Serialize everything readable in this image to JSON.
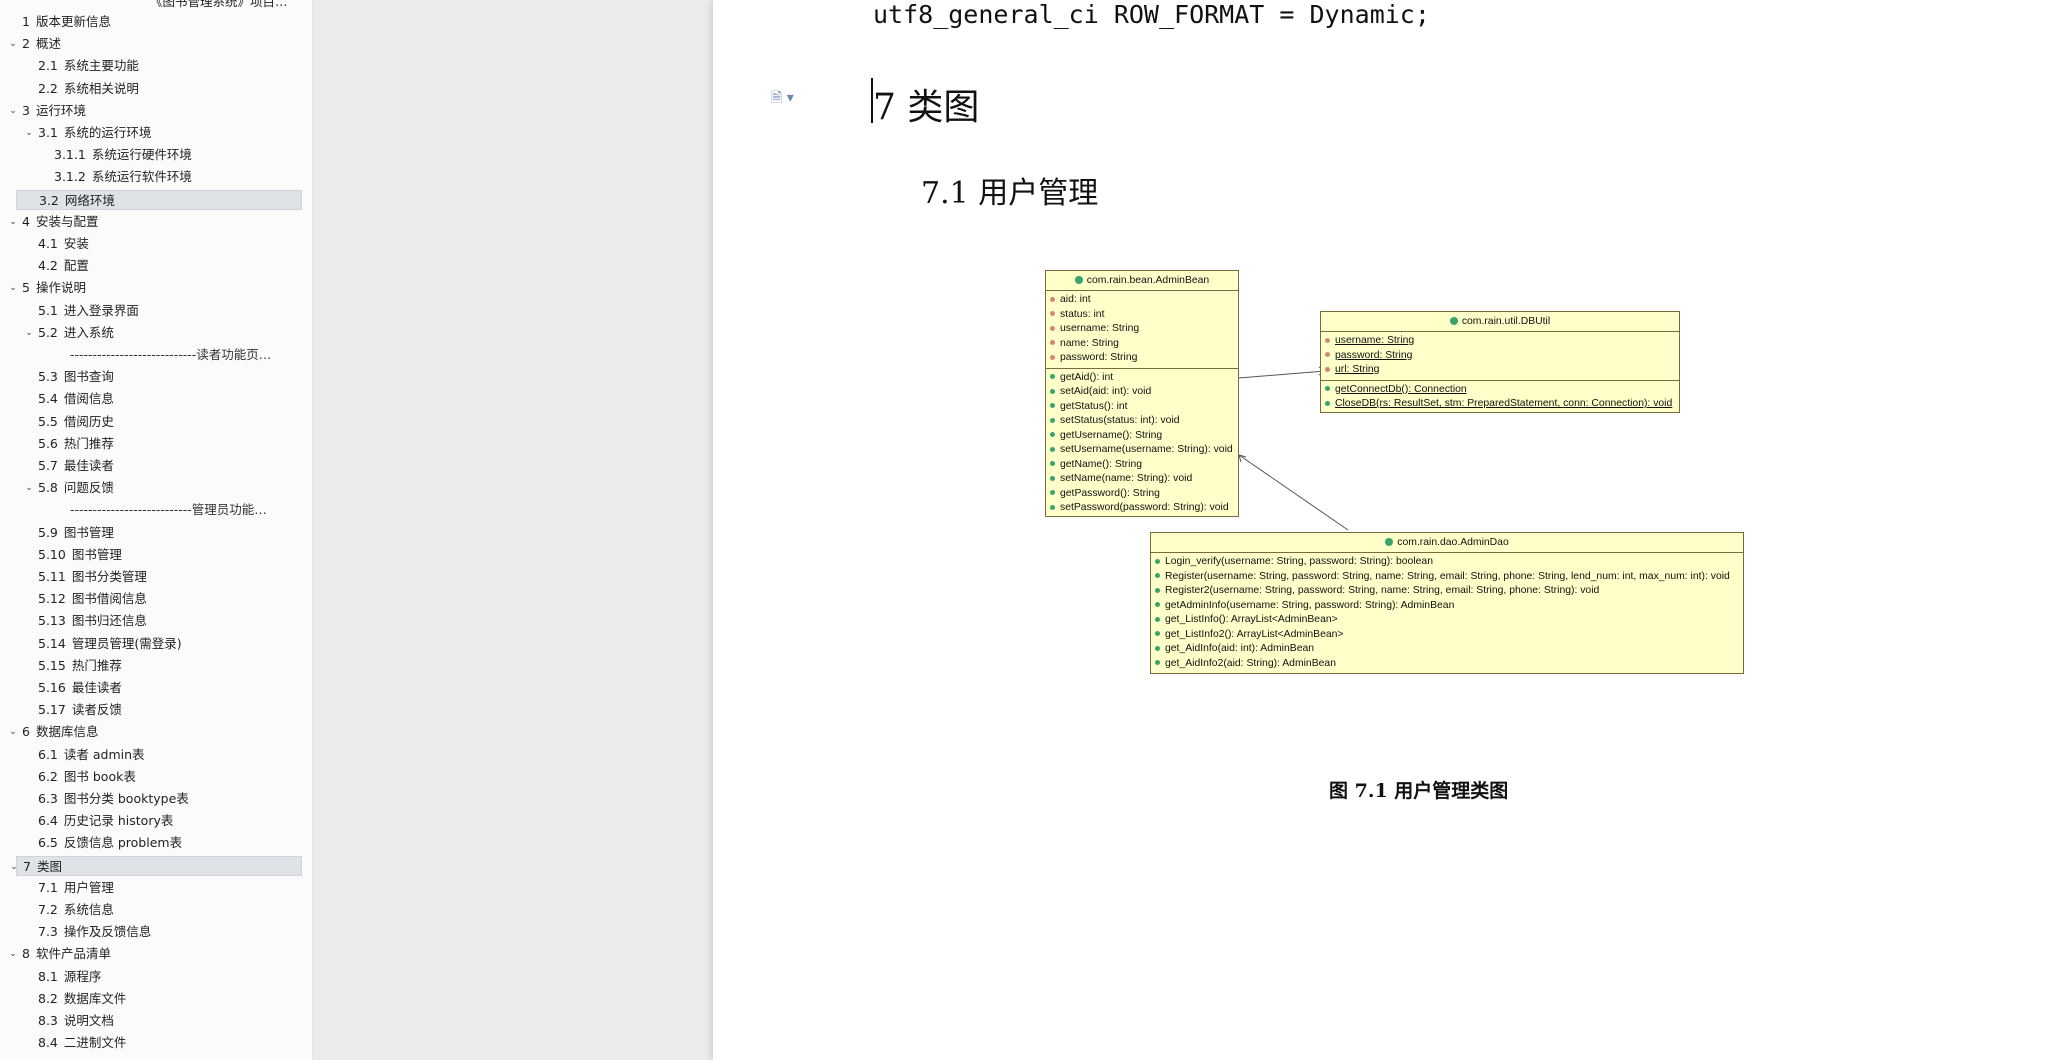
{
  "nav": {
    "top_partial": "《图书管理系统》项目…",
    "items": [
      {
        "num": "1",
        "label": "版本更新信息",
        "level": 1,
        "chev": false
      },
      {
        "num": "2",
        "label": "概述",
        "level": 1,
        "chev": true
      },
      {
        "num": "2.1",
        "label": "系统主要功能",
        "level": 2,
        "chev": false
      },
      {
        "num": "2.2",
        "label": "系统相关说明",
        "level": 2,
        "chev": false
      },
      {
        "num": "3",
        "label": "运行环境",
        "level": 1,
        "chev": true
      },
      {
        "num": "3.1",
        "label": "系统的运行环境",
        "level": 2,
        "chev": true
      },
      {
        "num": "3.1.1",
        "label": "系统运行硬件环境",
        "level": 3,
        "chev": false
      },
      {
        "num": "3.1.2",
        "label": "系统运行软件环境",
        "level": 3,
        "chev": false
      },
      {
        "num": "3.2",
        "label": "网络环境",
        "level": 2,
        "chev": false,
        "selected": true
      },
      {
        "num": "4",
        "label": "安装与配置",
        "level": 1,
        "chev": true
      },
      {
        "num": "4.1",
        "label": "安装",
        "level": 2,
        "chev": false
      },
      {
        "num": "4.2",
        "label": "配置",
        "level": 2,
        "chev": false
      },
      {
        "num": "5",
        "label": "操作说明",
        "level": 1,
        "chev": true
      },
      {
        "num": "5.1",
        "label": "进入登录界面",
        "level": 2,
        "chev": false
      },
      {
        "num": "5.2",
        "label": "进入系统",
        "level": 2,
        "chev": true
      },
      {
        "num": "",
        "label": "----------------------------读者功能页…",
        "level": 4,
        "chev": false
      },
      {
        "num": "5.3",
        "label": "图书查询",
        "level": 2,
        "chev": false
      },
      {
        "num": "5.4",
        "label": "借阅信息",
        "level": 2,
        "chev": false
      },
      {
        "num": "5.5",
        "label": "借阅历史",
        "level": 2,
        "chev": false
      },
      {
        "num": "5.6",
        "label": "热门推荐",
        "level": 2,
        "chev": false
      },
      {
        "num": "5.7",
        "label": "最佳读者",
        "level": 2,
        "chev": false
      },
      {
        "num": "5.8",
        "label": "问题反馈",
        "level": 2,
        "chev": true
      },
      {
        "num": "",
        "label": "---------------------------管理员功能…",
        "level": 4,
        "chev": false
      },
      {
        "num": "5.9",
        "label": "图书管理",
        "level": 2,
        "chev": false
      },
      {
        "num": "5.10",
        "label": "图书管理",
        "level": 2,
        "chev": false
      },
      {
        "num": "5.11",
        "label": "图书分类管理",
        "level": 2,
        "chev": false
      },
      {
        "num": "5.12",
        "label": "图书借阅信息",
        "level": 2,
        "chev": false
      },
      {
        "num": "5.13",
        "label": "图书归还信息",
        "level": 2,
        "chev": false
      },
      {
        "num": "5.14",
        "label": "管理员管理(需登录)",
        "level": 2,
        "chev": false
      },
      {
        "num": "5.15",
        "label": "热门推荐",
        "level": 2,
        "chev": false
      },
      {
        "num": "5.16",
        "label": "最佳读者",
        "level": 2,
        "chev": false
      },
      {
        "num": "5.17",
        "label": "读者反馈",
        "level": 2,
        "chev": false
      },
      {
        "num": "6",
        "label": "数据库信息",
        "level": 1,
        "chev": true
      },
      {
        "num": "6.1",
        "label": "读者 admin表",
        "level": 2,
        "chev": false
      },
      {
        "num": "6.2",
        "label": "图书 book表",
        "level": 2,
        "chev": false
      },
      {
        "num": "6.3",
        "label": "图书分类 booktype表",
        "level": 2,
        "chev": false
      },
      {
        "num": "6.4",
        "label": "历史记录 history表",
        "level": 2,
        "chev": false
      },
      {
        "num": "6.5",
        "label": "反馈信息 problem表",
        "level": 2,
        "chev": false
      },
      {
        "num": "7",
        "label": "类图",
        "level": 1,
        "chev": true,
        "selected": true
      },
      {
        "num": "7.1",
        "label": "用户管理",
        "level": 2,
        "chev": false
      },
      {
        "num": "7.2",
        "label": "系统信息",
        "level": 2,
        "chev": false
      },
      {
        "num": "7.3",
        "label": "操作及反馈信息",
        "level": 2,
        "chev": false
      },
      {
        "num": "8",
        "label": "软件产品清单",
        "level": 1,
        "chev": true
      },
      {
        "num": "8.1",
        "label": "源程序",
        "level": 2,
        "chev": false
      },
      {
        "num": "8.2",
        "label": "数据库文件",
        "level": 2,
        "chev": false
      },
      {
        "num": "8.3",
        "label": "说明文档",
        "level": 2,
        "chev": false
      },
      {
        "num": "8.4",
        "label": "二进制文件",
        "level": 2,
        "chev": false
      }
    ]
  },
  "doc": {
    "code_line": "utf8_general_ci ROW_FORMAT = Dynamic;",
    "heading1": "7 类图",
    "heading2": "7.1 用户管理",
    "caption": "图 7.1 用户管理类图",
    "paragraph_icon": "document-icon"
  },
  "uml": {
    "admin_bean": {
      "title": "com.rain.bean.AdminBean",
      "fields": [
        "aid: int",
        "status: int",
        "username: String",
        "name: String",
        "password: String"
      ],
      "methods": [
        "getAid(): int",
        "setAid(aid: int): void",
        "getStatus(): int",
        "setStatus(status: int): void",
        "getUsername(): String",
        "setUsername(username: String): void",
        "getName(): String",
        "setName(name: String): void",
        "getPassword(): String",
        "setPassword(password: String): void"
      ]
    },
    "db_util": {
      "title": "com.rain.util.DBUtil",
      "fields": [
        "username: String",
        "password: String",
        "url: String"
      ],
      "methods": [
        "getConnectDb(): Connection",
        "CloseDB(rs: ResultSet, stm: PreparedStatement, conn: Connection): void"
      ]
    },
    "admin_dao": {
      "title": "com.rain.dao.AdminDao",
      "methods": [
        "Login_verify(username: String, password: String): boolean",
        "Register(username: String, password: String, name: String, email: String, phone: String, lend_num: int, max_num: int): void",
        "Register2(username: String, password: String, name: String, email: String, phone: String): void",
        "getAdminInfo(username: String, password: String): AdminBean",
        "get_ListInfo(): ArrayList<AdminBean>",
        "get_ListInfo2(): ArrayList<AdminBean>",
        "get_AidInfo(aid: int): AdminBean",
        "get_AidInfo2(aid: String): AdminBean"
      ]
    }
  },
  "colors": {
    "uml_fill": "#ffffca",
    "uml_border": "#7a6a3a",
    "nav_selected": "#dfe3e8",
    "method_dot": "#3aa56b",
    "field_dot": "#d48a6a"
  }
}
